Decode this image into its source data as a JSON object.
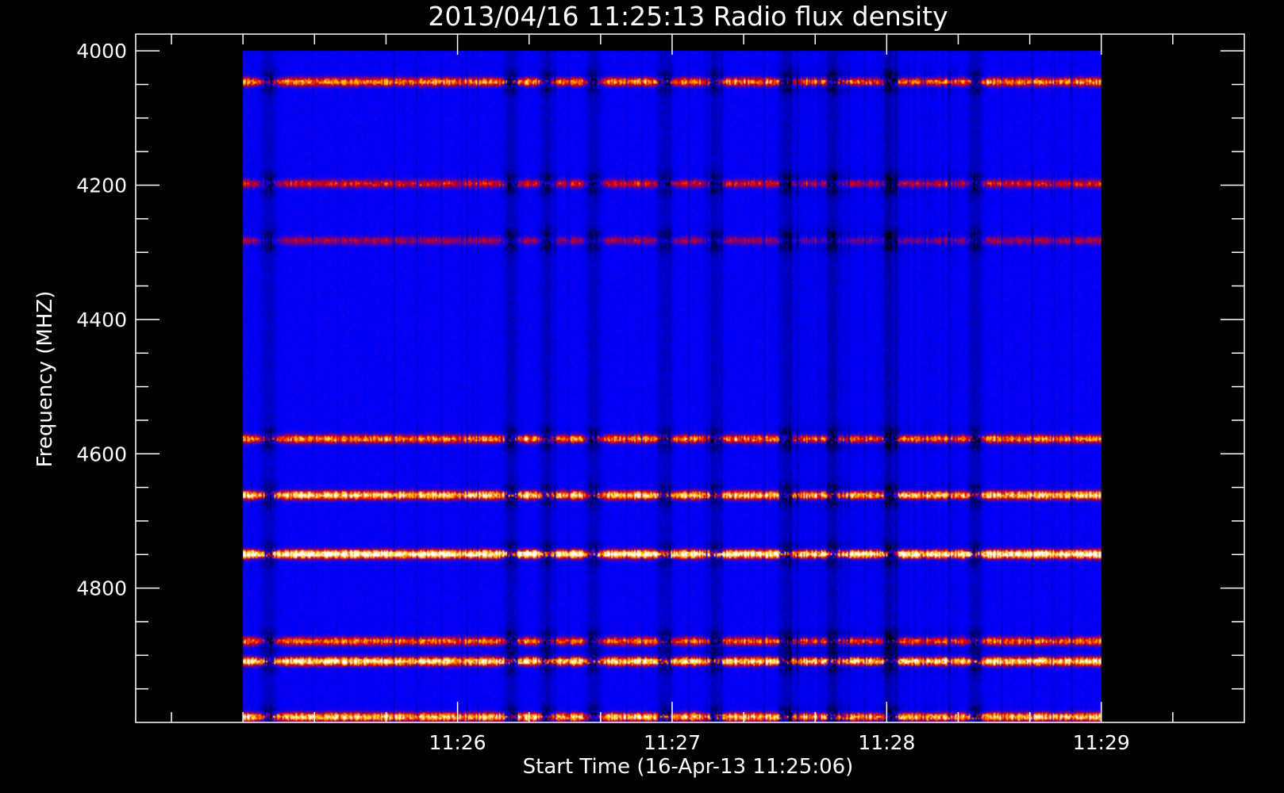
{
  "chart_data": {
    "type": "heatmap",
    "title": "2013/04/16 11:25:13 Radio flux density",
    "xlabel": "Start Time (16-Apr-13 11:25:06)",
    "ylabel": "Frequency (MHZ)",
    "x_ticks": [
      "11:26",
      "11:27",
      "11:28",
      "11:29"
    ],
    "y_ticks": [
      "4000",
      "4200",
      "4400",
      "4600",
      "4800"
    ],
    "x_tick_seconds": [
      60,
      120,
      180,
      240
    ],
    "y_tick_values": [
      4000,
      4200,
      4400,
      4600,
      4800
    ],
    "xlim_seconds": [
      -30,
      280
    ],
    "ylim_mhz": [
      3975,
      5000
    ],
    "data_extent": {
      "time_seconds": [
        0,
        240
      ],
      "frequency_mhz": [
        4000,
        5000
      ]
    },
    "colormap": [
      "#000000",
      "#0000ff",
      "#ff0000",
      "#ffcc00",
      "#ffffff"
    ],
    "background": "#0b0bff",
    "bright_bands_mhz": [
      {
        "center": 4045,
        "intensity": 0.55
      },
      {
        "center": 4197,
        "intensity": 0.35
      },
      {
        "center": 4282,
        "intensity": 0.25
      },
      {
        "center": 4578,
        "intensity": 0.55
      },
      {
        "center": 4662,
        "intensity": 0.75
      },
      {
        "center": 4750,
        "intensity": 0.95
      },
      {
        "center": 4880,
        "intensity": 0.5
      },
      {
        "center": 4910,
        "intensity": 0.8
      },
      {
        "center": 4993,
        "intensity": 0.7
      }
    ],
    "dark_columns_seconds": [
      7,
      75,
      85,
      98,
      118,
      132,
      152,
      165,
      181,
      205
    ],
    "grid": false
  }
}
